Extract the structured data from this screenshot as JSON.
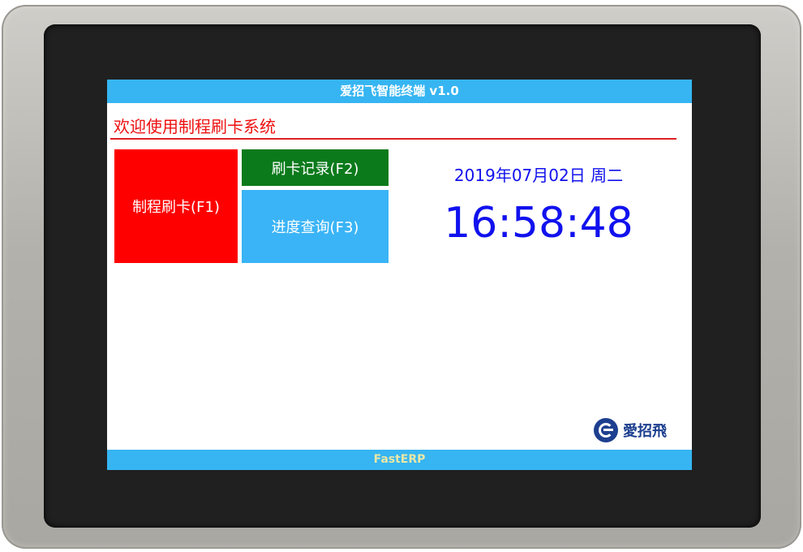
{
  "header": {
    "title": "爱招飞智能终端 v1.0"
  },
  "welcome": {
    "text": "欢迎使用制程刷卡系统"
  },
  "buttons": {
    "f1": "制程刷卡(F1)",
    "f2": "刷卡记录(F2)",
    "f3": "进度查询(F3)"
  },
  "clock": {
    "date": "2019年07月02日 周二",
    "time": "16:58:48"
  },
  "logo": {
    "text": "愛招飛"
  },
  "footer": {
    "text": "FastERP"
  },
  "colors": {
    "title_bar": "#36b5f2",
    "welcome_text": "#ee1111",
    "f1_button": "#ff0000",
    "f2_button": "#0b7a1b",
    "f3_button": "#3ab4f6",
    "clock_text": "#1111ee"
  },
  "icons": {
    "logo": "aizhaofei-logo-icon"
  }
}
